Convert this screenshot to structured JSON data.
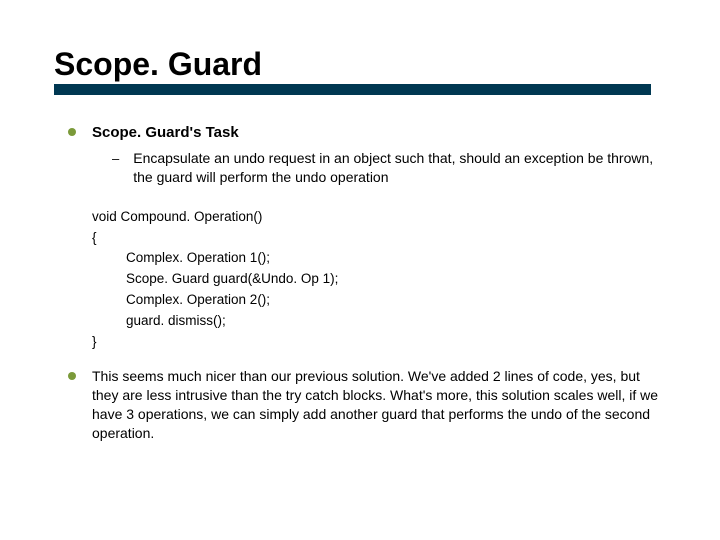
{
  "title": "Scope. Guard",
  "bullet1": "Scope. Guard's Task",
  "subbullet1": "Encapsulate an undo request in an object such that, should an exception be thrown, the guard will perform the undo operation",
  "code": {
    "l1": "void Compound. Operation()",
    "l2": "{",
    "l3": "Complex. Operation 1();",
    "l4": "Scope. Guard guard(&Undo. Op 1);",
    "l5": "Complex. Operation 2();",
    "l6": "guard. dismiss();",
    "l7": "}"
  },
  "para": "This seems much nicer than our previous solution.  We've added 2 lines of code, yes, but they are less intrusive than the try catch blocks.  What's more, this solution scales well, if we have 3 operations, we can simply add another guard that performs the undo of the second operation."
}
